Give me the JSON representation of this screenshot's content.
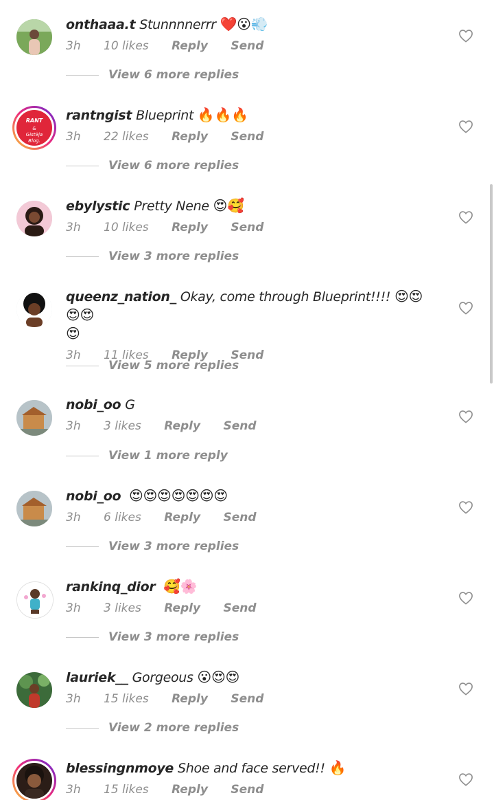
{
  "comments": [
    {
      "username": "onthaaa.t",
      "text": "Stunnnnerrr",
      "emoji": "❤️😮💨",
      "time": "3h",
      "likes": "10 likes",
      "reply_label": "Reply",
      "send_label": "Send",
      "view_more": "View 6 more replies",
      "avatar": "outdoor-photo"
    },
    {
      "username": "rantngist",
      "text": "Blueprint",
      "emoji": "🔥🔥🔥",
      "time": "3h",
      "likes": "22 likes",
      "reply_label": "Reply",
      "send_label": "Send",
      "view_more": "View 6 more replies",
      "avatar": "rant-logo",
      "avatar_text": "RANT & Gist9ja Blog."
    },
    {
      "username": "ebylystic",
      "text": "Pretty Nene",
      "emoji": "😍🥰",
      "time": "3h",
      "likes": "10 likes",
      "reply_label": "Reply",
      "send_label": "Send",
      "view_more": "View 3 more replies",
      "avatar": "portrait"
    },
    {
      "username": "queenz_nation_",
      "text": "Okay, come through Blueprint!!!!",
      "emoji": "😍😍😍😍",
      "emoji_line2": "😍",
      "time": "3h",
      "likes": "11 likes",
      "reply_label": "Reply",
      "send_label": "Send",
      "view_more": "View 5 more replies",
      "avatar": "afro-portrait"
    },
    {
      "username": "nobi_oo",
      "text": "G",
      "emoji": "",
      "time": "3h",
      "likes": "3 likes",
      "reply_label": "Reply",
      "send_label": "Send",
      "view_more": "View 1 more reply",
      "avatar": "building-photo"
    },
    {
      "username": "nobi_oo",
      "text": "",
      "emoji": "😍😍😍😍😍😍😍",
      "time": "3h",
      "likes": "6 likes",
      "reply_label": "Reply",
      "send_label": "Send",
      "view_more": "View 3 more replies",
      "avatar": "building-photo"
    },
    {
      "username": "rankinq_dior",
      "text": "",
      "emoji": "🥰🌸",
      "time": "3h",
      "likes": "3 likes",
      "reply_label": "Reply",
      "send_label": "Send",
      "view_more": "View 3 more replies",
      "avatar": "cartoon"
    },
    {
      "username": "lauriek__",
      "text": "Gorgeous",
      "emoji": "😮😍😍",
      "time": "3h",
      "likes": "15 likes",
      "reply_label": "Reply",
      "send_label": "Send",
      "view_more": "View 2 more replies",
      "avatar": "garden-photo"
    },
    {
      "username": "blessingnmoye",
      "text": "Shoe and face served!!",
      "emoji": "🔥",
      "time": "3h",
      "likes": "15 likes",
      "reply_label": "Reply",
      "send_label": "Send",
      "view_more": "",
      "avatar": "story-ring-portrait"
    }
  ],
  "colors": {
    "text": "#262626",
    "meta": "#8e8e8e",
    "heart_outline": "#8e8e8e"
  },
  "icons": {
    "like": "heart-outline-icon"
  }
}
